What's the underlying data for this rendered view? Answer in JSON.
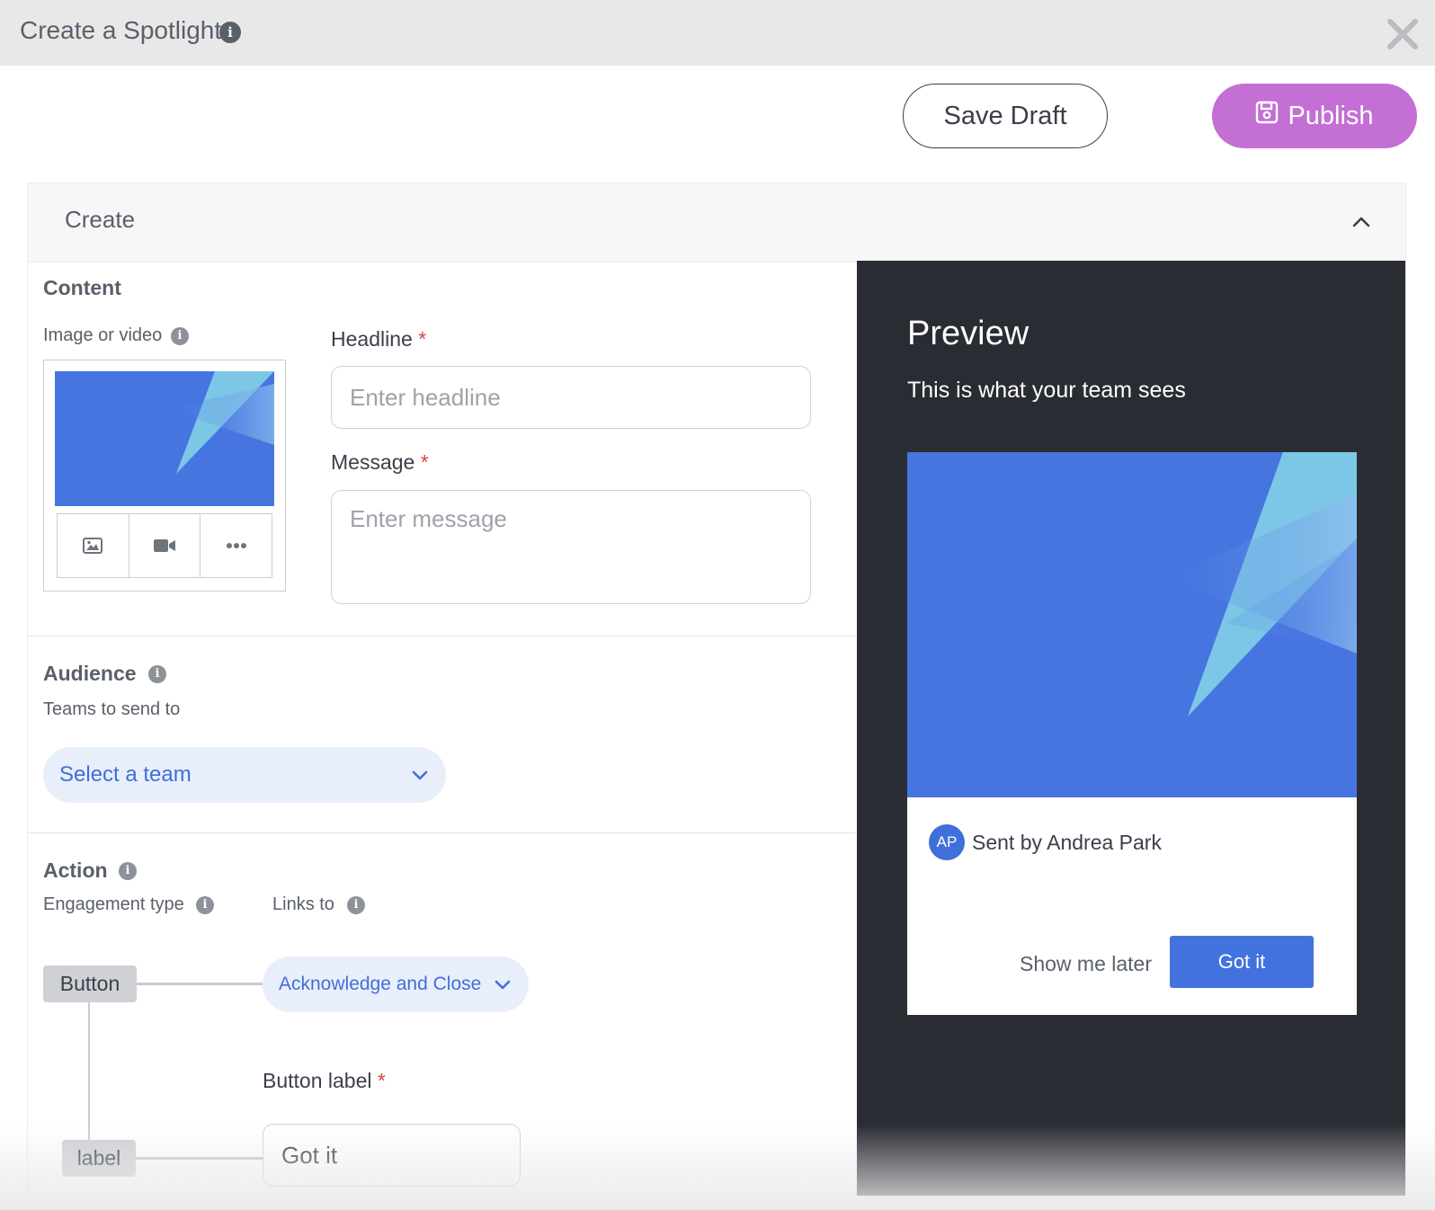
{
  "window": {
    "title": "Create a Spotlight"
  },
  "header": {
    "save_draft_label": "Save Draft",
    "publish_label": "Publish"
  },
  "panel": {
    "title": "Create"
  },
  "content": {
    "section_title": "Content",
    "media_label": "Image or video",
    "headline_label": "Headline",
    "headline_placeholder": "Enter headline",
    "message_label": "Message",
    "message_placeholder": "Enter message",
    "required_mark": "*"
  },
  "audience": {
    "section_title": "Audience",
    "teams_label": "Teams to send to",
    "team_select_value": "Select a team"
  },
  "action": {
    "section_title": "Action",
    "engagement_label": "Engagement type",
    "links_label": "Links to",
    "node_button": "Button",
    "node_label": "label",
    "links_select_value": "Acknowledge and Close",
    "button_label_label": "Button label",
    "button_label_value": "Got it"
  },
  "preview": {
    "title": "Preview",
    "subtitle": "This is what your team sees",
    "avatar_initials": "AP",
    "sender_text": "Sent by Andrea Park",
    "later_label": "Show me later",
    "got_it_label": "Got it"
  },
  "colors": {
    "accent_blue": "#3f6fd8",
    "publish_purple": "#c36fd3",
    "preview_bg": "#2a2c34",
    "image_blue": "#4675e0",
    "image_light_blue": "#7cc7e6"
  }
}
